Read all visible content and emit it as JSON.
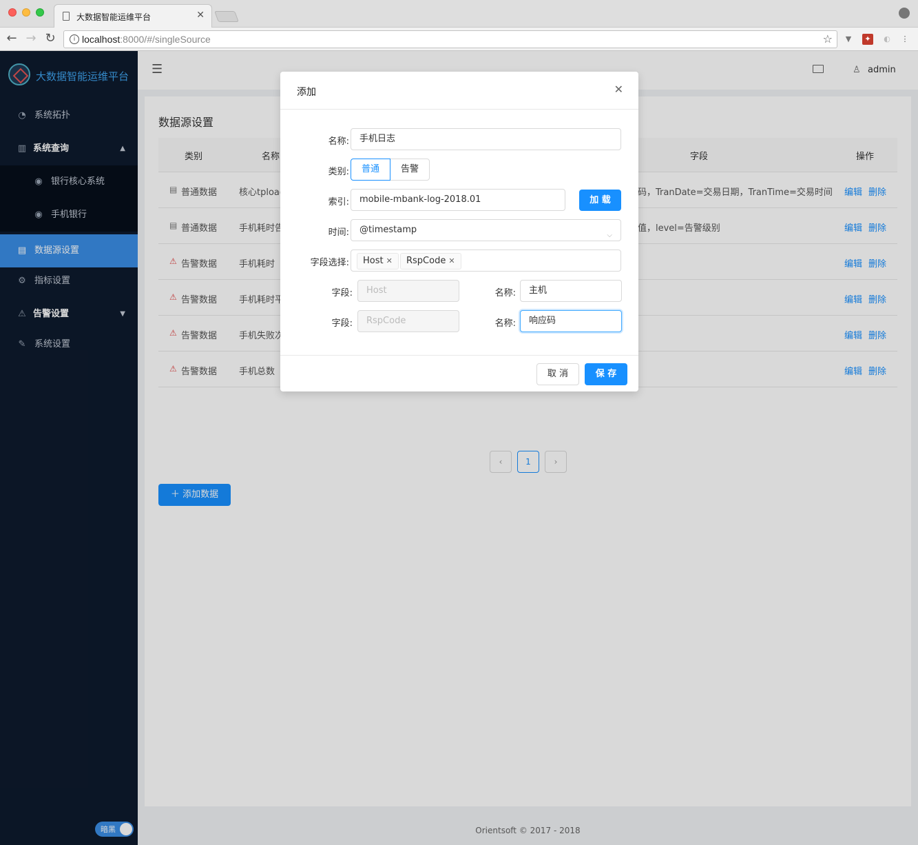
{
  "browser": {
    "tab_title": "大数据智能运维平台",
    "url_host": "localhost",
    "url_rest": ":8000/#/singleSource"
  },
  "sidebar": {
    "logo_text": "大数据智能运维平台",
    "items": [
      {
        "label": "系统拓扑"
      },
      {
        "label": "系统查询"
      },
      {
        "label": "银行核心系统"
      },
      {
        "label": "手机银行"
      },
      {
        "label": "数据源设置"
      },
      {
        "label": "指标设置"
      },
      {
        "label": "告警设置"
      },
      {
        "label": "系统设置"
      }
    ],
    "theme_label": "暗黑"
  },
  "header": {
    "user": "admin"
  },
  "page": {
    "title": "数据源设置",
    "columns": [
      "类别",
      "名称",
      "字段",
      "操作"
    ],
    "rows": [
      {
        "type": "普通数据",
        "icon": "normal",
        "name": "核心tpload",
        "fields": "码，TranDate=交易日期，TranTime=交易时间"
      },
      {
        "type": "普通数据",
        "icon": "normal",
        "name": "手机耗时告",
        "fields": "值，level=告警级别"
      },
      {
        "type": "告警数据",
        "icon": "alert",
        "name": "手机耗时",
        "fields": ""
      },
      {
        "type": "告警数据",
        "icon": "alert",
        "name": "手机耗时平",
        "fields": ""
      },
      {
        "type": "告警数据",
        "icon": "alert",
        "name": "手机失败次",
        "fields": ""
      },
      {
        "type": "告警数据",
        "icon": "alert",
        "name": "手机总数",
        "fields": ""
      }
    ],
    "edit_label": "编辑",
    "delete_label": "删除",
    "current_page": "1",
    "add_button": "添加数据"
  },
  "footer": "Orientsoft © 2017 - 2018",
  "modal": {
    "title": "添加",
    "name_label": "名称:",
    "name_value": "手机日志",
    "type_label": "类别:",
    "type_options": [
      "普通",
      "告警"
    ],
    "type_selected": "普通",
    "index_label": "索引:",
    "index_value": "mobile-mbank-log-2018.01",
    "load_button": "加 载",
    "time_label": "时间:",
    "time_value": "@timestamp",
    "fields_label": "字段选择:",
    "selected_fields": [
      "Host",
      "RspCode"
    ],
    "field_rows": [
      {
        "field_label": "字段:",
        "field_placeholder": "Host",
        "name_label": "名称:",
        "name_value": "主机"
      },
      {
        "field_label": "字段:",
        "field_placeholder": "RspCode",
        "name_label": "名称:",
        "name_value": "响应码"
      }
    ],
    "cancel_button": "取 消",
    "save_button": "保 存"
  },
  "colors": {
    "primary": "#1890ff",
    "sidebar_bg": "#0e1a2d",
    "alert": "#e24a4a"
  }
}
